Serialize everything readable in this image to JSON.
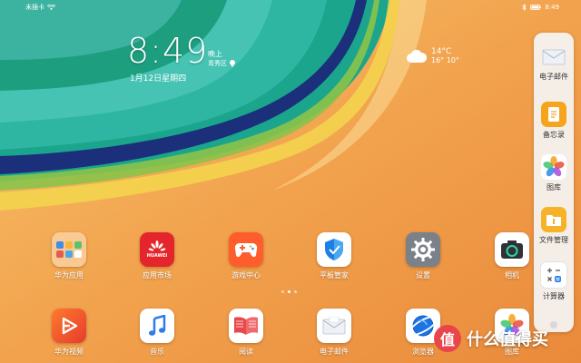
{
  "status_bar": {
    "carrier_text": "未插卡",
    "time": "8:49"
  },
  "lock_clock": {
    "time": "8:49",
    "ampm": "晚上",
    "location": "青秀区",
    "date": "1月12日星期四"
  },
  "weather": {
    "temp": "14°C",
    "range": "16° 10°",
    "icon": "cloud-icon"
  },
  "apps_row1": [
    {
      "label": "华为应用",
      "icon": "folder-icon"
    },
    {
      "label": "应用市场",
      "icon": "huawei-appgallery-icon"
    },
    {
      "label": "游戏中心",
      "icon": "gamepad-icon"
    },
    {
      "label": "平板管家",
      "icon": "shield-icon"
    },
    {
      "label": "设置",
      "icon": "gear-icon"
    },
    {
      "label": "相机",
      "icon": "camera-icon"
    }
  ],
  "apps_row2": [
    {
      "label": "华为视频",
      "icon": "play-icon"
    },
    {
      "label": "音乐",
      "icon": "music-note-icon"
    },
    {
      "label": "阅读",
      "icon": "book-icon"
    },
    {
      "label": "电子邮件",
      "icon": "envelope-icon"
    },
    {
      "label": "浏览器",
      "icon": "globe-icon"
    },
    {
      "label": "图库",
      "icon": "flower-icon"
    }
  ],
  "huawei_logo_text": "HUAWEI",
  "dock": [
    {
      "label": "电子邮件",
      "icon": "envelope-icon"
    },
    {
      "label": "备忘录",
      "icon": "notepad-icon"
    },
    {
      "label": "图库",
      "icon": "flower-icon"
    },
    {
      "label": "文件管理",
      "icon": "folder-icon"
    },
    {
      "label": "计算器",
      "icon": "calculator-icon"
    }
  ],
  "page_indicator": {
    "pages": 3,
    "current": 2
  },
  "watermark": {
    "badge": "值",
    "text": "什么值得买"
  },
  "colors": {
    "wallpaper_orange": "#f0a04a",
    "wallpaper_teal": "#1fa88f",
    "wallpaper_navy": "#1b2f7a"
  }
}
